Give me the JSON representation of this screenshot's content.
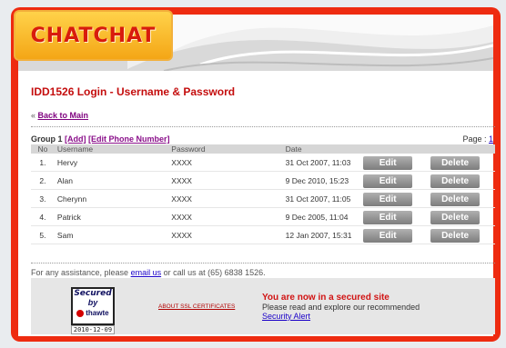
{
  "brand": {
    "logo_text": "CHATCHAT"
  },
  "page": {
    "title": "IDD1526 Login - Username & Password",
    "back_prefix": "«",
    "back_link": "Back to Main"
  },
  "group": {
    "label": "Group 1",
    "add": "[Add]",
    "edit_phone": "[Edit Phone Number]",
    "page_label": "Page :",
    "page_number": "1"
  },
  "table": {
    "headers": [
      "No",
      "Username",
      "Password",
      "Date"
    ],
    "edit_label": "Edit",
    "delete_label": "Delete",
    "rows": [
      {
        "no": "1.",
        "username": "Hervy",
        "password": "XXXX",
        "date": "31 Oct 2007, 11:03"
      },
      {
        "no": "2.",
        "username": "Alan",
        "password": "XXXX",
        "date": "9 Dec 2010, 15:23"
      },
      {
        "no": "3.",
        "username": "Cherynn",
        "password": "XXXX",
        "date": "31 Oct 2007, 11:05"
      },
      {
        "no": "4.",
        "username": "Patrick",
        "password": "XXXX",
        "date": "9 Dec 2005, 11:04"
      },
      {
        "no": "5.",
        "username": "Sam",
        "password": "XXXX",
        "date": "12 Jan 2007, 15:31"
      }
    ]
  },
  "assistance": {
    "prefix": "For any assistance, please",
    "email_link": "email us",
    "suffix": "or call us at (65) 6838 1526."
  },
  "footer": {
    "seal_secured": "Secured",
    "seal_by": "by",
    "seal_brand": "thawte",
    "seal_date": "2010-12-09",
    "ssl_link": "ABOUT SSL CERTIFICATES",
    "secured_title": "You are now in a secured site",
    "secured_text": "Please read and explore our recommended",
    "security_alert": "Security Alert"
  },
  "colors": {
    "frame": "#ee2b10",
    "title": "#c40d0d",
    "link": "#1a00c8",
    "button": "#8c8c8c",
    "logo": "#ffd24a"
  }
}
